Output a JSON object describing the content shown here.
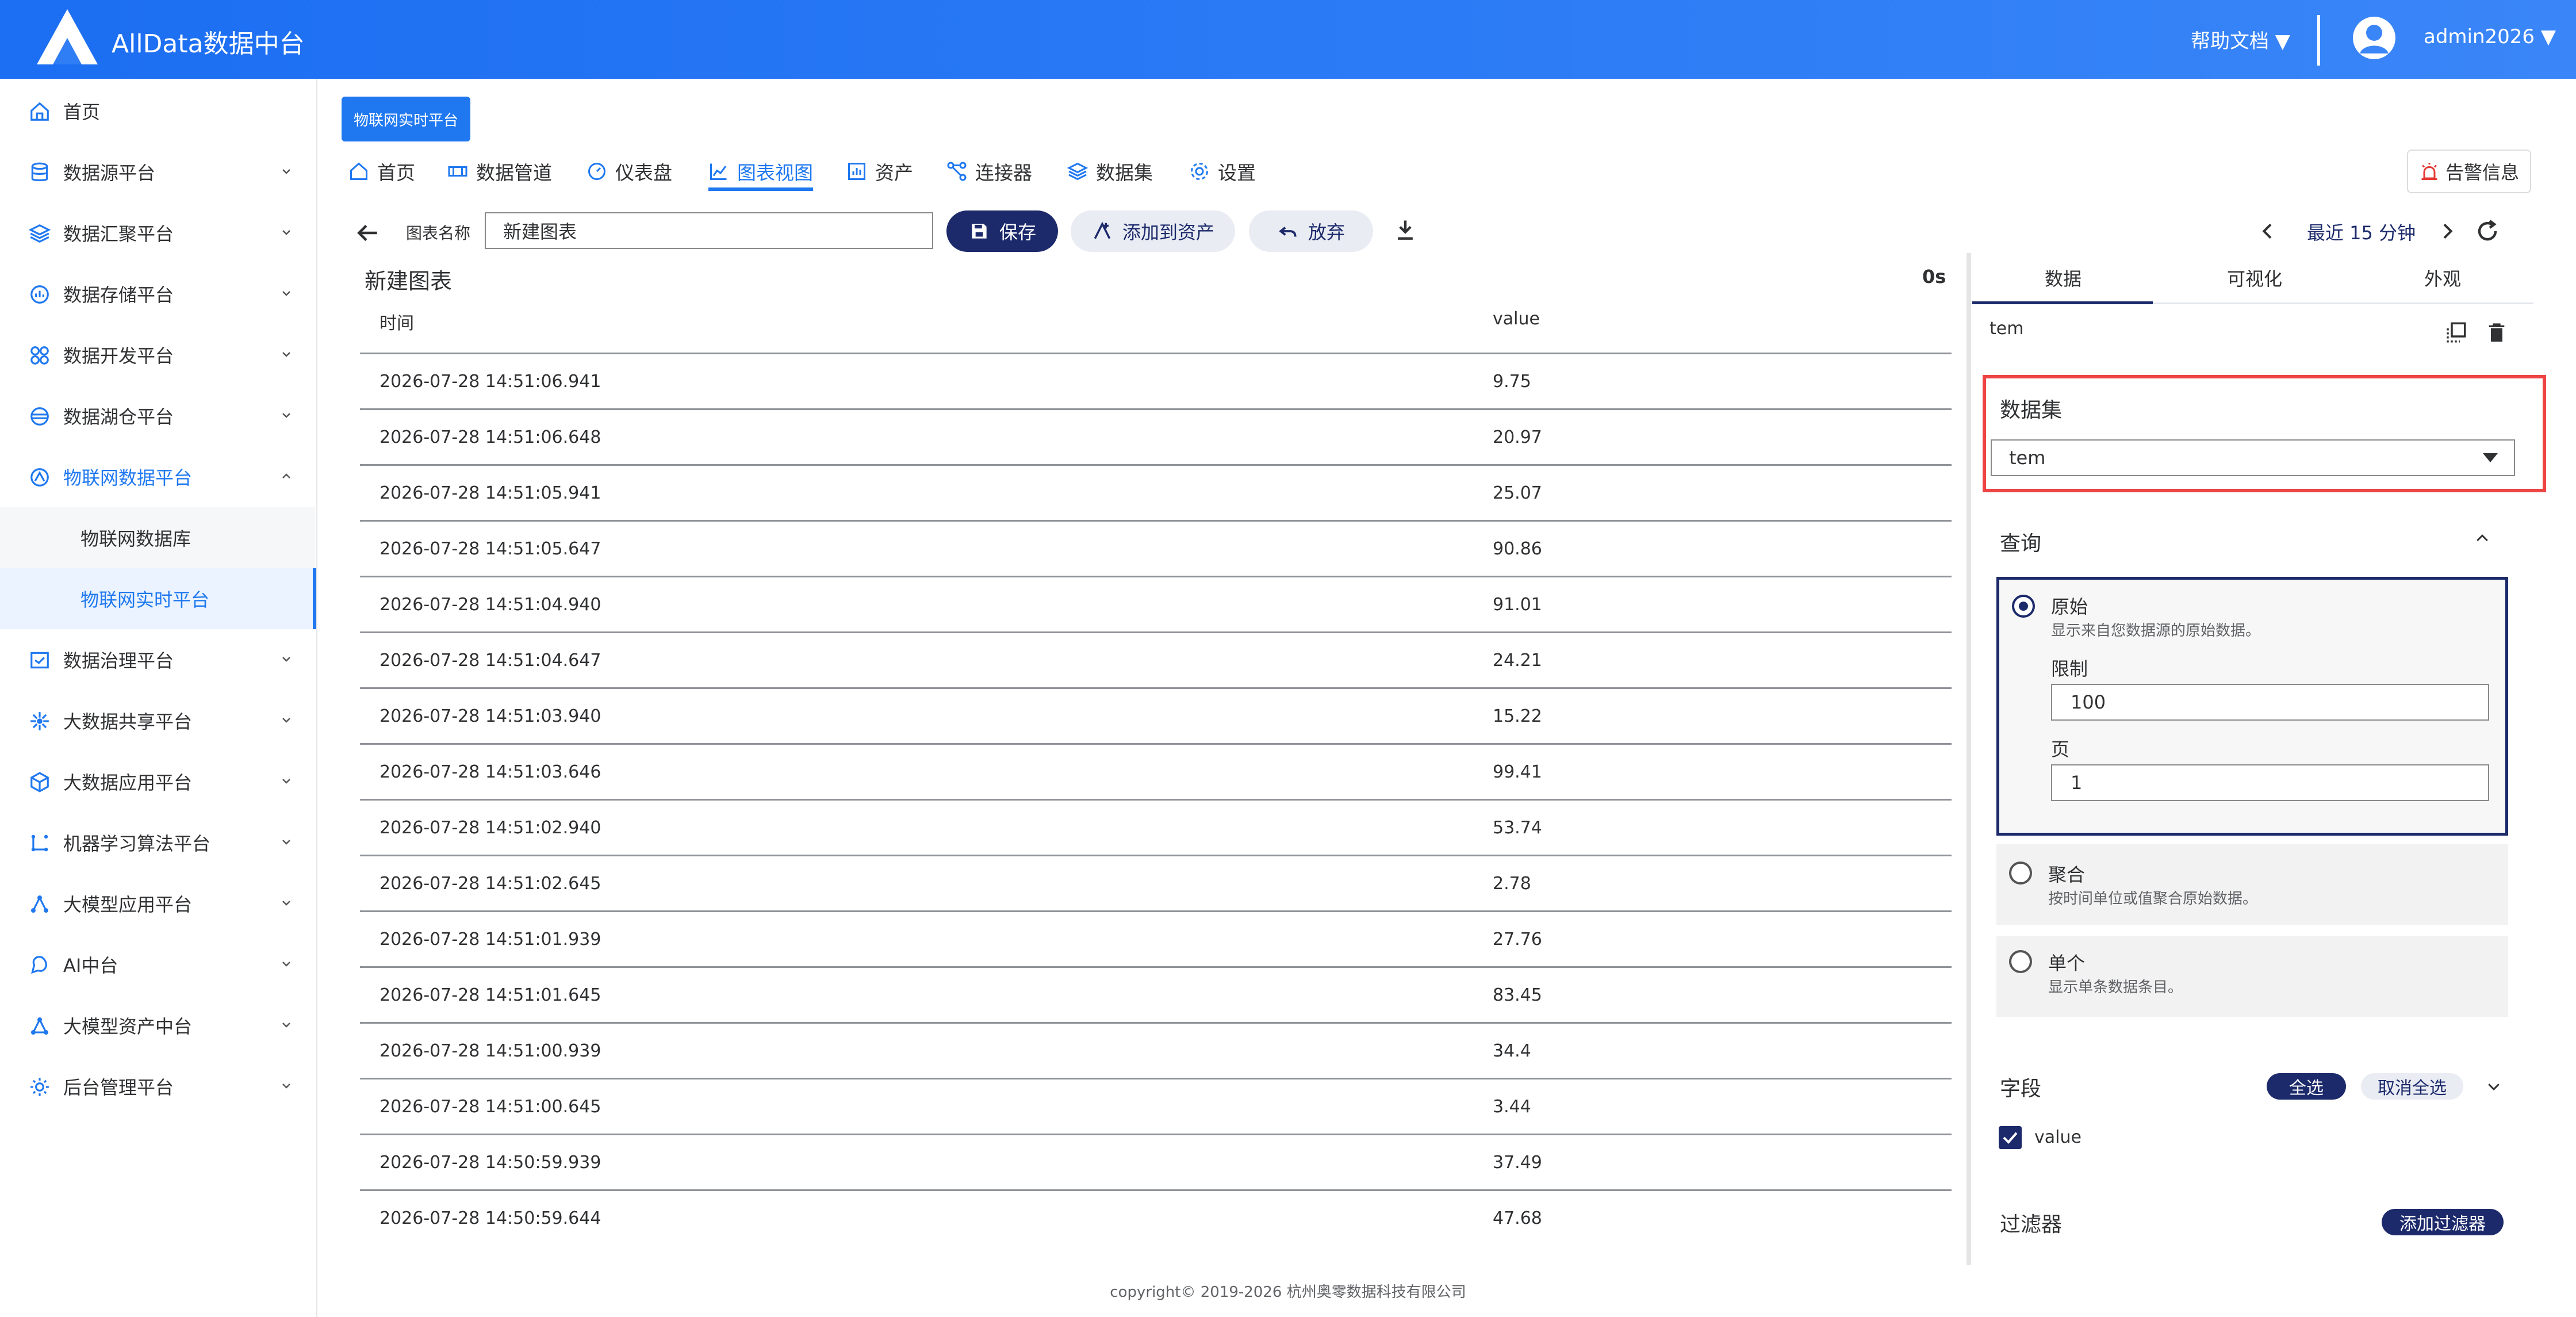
{
  "header": {
    "app_title": "AllData数据中台",
    "help_label": "帮助文档 ▼",
    "user_label": "admin2026 ▼"
  },
  "sidebar": {
    "items": [
      {
        "label": "首页",
        "icon": "home-icon"
      },
      {
        "label": "数据源平台",
        "icon": "database-icon"
      },
      {
        "label": "数据汇聚平台",
        "icon": "layers-icon"
      },
      {
        "label": "数据存储平台",
        "icon": "storage-icon"
      },
      {
        "label": "数据开发平台",
        "icon": "grid-icon"
      },
      {
        "label": "数据湖仓平台",
        "icon": "lake-icon"
      },
      {
        "label": "物联网数据平台",
        "icon": "iot-icon"
      },
      {
        "label": "物联网数据库",
        "icon": ""
      },
      {
        "label": "物联网实时平台",
        "icon": ""
      },
      {
        "label": "数据治理平台",
        "icon": "governance-icon"
      },
      {
        "label": "大数据共享平台",
        "icon": "share-icon"
      },
      {
        "label": "大数据应用平台",
        "icon": "cube-icon"
      },
      {
        "label": "机器学习算法平台",
        "icon": "ml-icon"
      },
      {
        "label": "大模型应用平台",
        "icon": "model-icon"
      },
      {
        "label": "AI中台",
        "icon": "ai-icon"
      },
      {
        "label": "大模型资产中台",
        "icon": "asset-icon"
      },
      {
        "label": "后台管理平台",
        "icon": "admin-icon"
      }
    ]
  },
  "content": {
    "platform_tag": "物联网实时平台",
    "tabs": [
      {
        "label": "首页",
        "icon": "home-icon"
      },
      {
        "label": "数据管道",
        "icon": "pipeline-icon"
      },
      {
        "label": "仪表盘",
        "icon": "dashboard-icon"
      },
      {
        "label": "图表视图",
        "icon": "chart-icon"
      },
      {
        "label": "资产",
        "icon": "asset-icon"
      },
      {
        "label": "连接器",
        "icon": "connector-icon"
      },
      {
        "label": "数据集",
        "icon": "dataset-icon"
      },
      {
        "label": "设置",
        "icon": "settings-icon"
      }
    ],
    "active_tab": "图表视图",
    "alert_label": "告警信息"
  },
  "toolbar": {
    "name_label": "图表名称",
    "name_value": "新建图表",
    "save_label": "保存",
    "add_asset_label": "添加到资产",
    "discard_label": "放弃",
    "time_range": "最近 15 分钟"
  },
  "table": {
    "title": "新建图表",
    "elapsed": "0s",
    "headers": [
      "时间",
      "value"
    ],
    "rows": [
      [
        "2026-07-28 14:51:06.941",
        "9.75"
      ],
      [
        "2026-07-28 14:51:06.648",
        "20.97"
      ],
      [
        "2026-07-28 14:51:05.941",
        "25.07"
      ],
      [
        "2026-07-28 14:51:05.647",
        "90.86"
      ],
      [
        "2026-07-28 14:51:04.940",
        "91.01"
      ],
      [
        "2026-07-28 14:51:04.647",
        "24.21"
      ],
      [
        "2026-07-28 14:51:03.940",
        "15.22"
      ],
      [
        "2026-07-28 14:51:03.646",
        "99.41"
      ],
      [
        "2026-07-28 14:51:02.940",
        "53.74"
      ],
      [
        "2026-07-28 14:51:02.645",
        "2.78"
      ],
      [
        "2026-07-28 14:51:01.939",
        "27.76"
      ],
      [
        "2026-07-28 14:51:01.645",
        "83.45"
      ],
      [
        "2026-07-28 14:51:00.939",
        "34.4"
      ],
      [
        "2026-07-28 14:51:00.645",
        "3.44"
      ],
      [
        "2026-07-28 14:50:59.939",
        "37.49"
      ],
      [
        "2026-07-28 14:50:59.644",
        "47.68"
      ]
    ]
  },
  "right_panel": {
    "tabs": [
      "数据",
      "可视化",
      "外观"
    ],
    "active_tab": "数据",
    "query_name": "tem",
    "dataset_label": "数据集",
    "dataset_value": "tem",
    "query_label": "查询",
    "raw": {
      "title": "原始",
      "desc": "显示来自您数据源的原始数据。",
      "limit_label": "限制",
      "limit_value": "100",
      "page_label": "页",
      "page_value": "1",
      "selected": true
    },
    "aggregate": {
      "title": "聚合",
      "desc": "按时间单位或值聚合原始数据。",
      "selected": false
    },
    "single": {
      "title": "单个",
      "desc": "显示单条数据条目。",
      "selected": false
    },
    "fields_label": "字段",
    "select_all": "全选",
    "deselect_all": "取消全选",
    "fields": [
      {
        "label": "value",
        "checked": true
      }
    ],
    "filters_label": "过滤器",
    "add_filter": "添加过滤器"
  },
  "footer": "copyright© 2019-2026 杭州奥零数据科技有限公司",
  "colors": {
    "primary": "#1f78f0",
    "navy": "#1c2a6b",
    "highlight": "#ee4444"
  }
}
